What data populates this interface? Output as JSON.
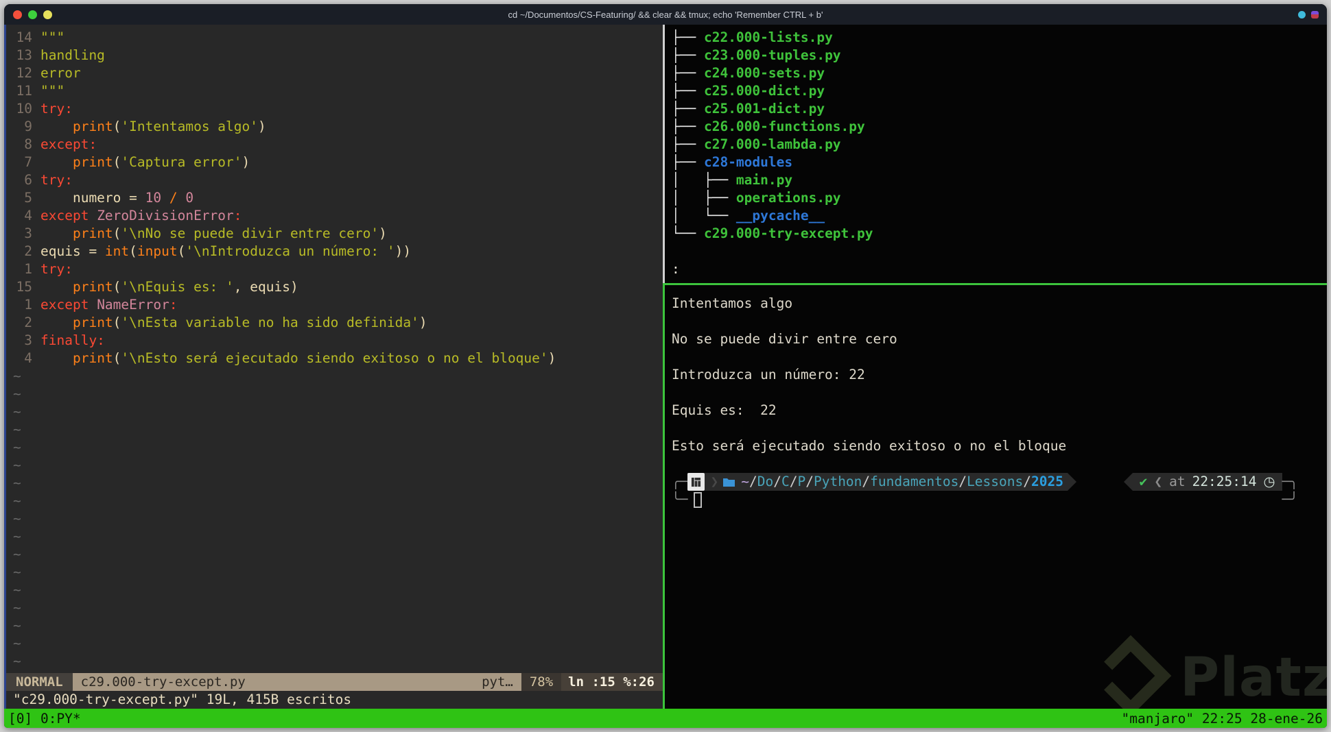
{
  "titlebar": {
    "title": "cd ~/Documentos/CS-Featuring/ && clear && tmux; echo 'Remember CTRL + b'"
  },
  "editor": {
    "lines": [
      {
        "n": "14",
        "parts": [
          [
            "\"\"\"",
            "str"
          ]
        ]
      },
      {
        "n": "13",
        "parts": [
          [
            "handling",
            "str"
          ]
        ]
      },
      {
        "n": "12",
        "parts": [
          [
            "error",
            "str"
          ]
        ]
      },
      {
        "n": "11",
        "parts": [
          [
            "\"\"\"",
            "str"
          ]
        ]
      },
      {
        "n": "10",
        "parts": [
          [
            "try:",
            "kw"
          ]
        ]
      },
      {
        "n": "9",
        "parts": [
          [
            "    ",
            "pl"
          ],
          [
            "print",
            "fn"
          ],
          [
            "(",
            "pl"
          ],
          [
            "'Intentamos algo'",
            "str"
          ],
          [
            ")",
            "pl"
          ]
        ]
      },
      {
        "n": "8",
        "parts": [
          [
            "except:",
            "kw"
          ]
        ]
      },
      {
        "n": "7",
        "parts": [
          [
            "    ",
            "pl"
          ],
          [
            "print",
            "fn"
          ],
          [
            "(",
            "pl"
          ],
          [
            "'Captura error'",
            "str"
          ],
          [
            ")",
            "pl"
          ]
        ]
      },
      {
        "n": "6",
        "parts": [
          [
            "try:",
            "kw"
          ]
        ]
      },
      {
        "n": "5",
        "parts": [
          [
            "    numero = ",
            "pl"
          ],
          [
            "10",
            "num"
          ],
          [
            " ",
            "pl"
          ],
          [
            "/",
            "fn"
          ],
          [
            " ",
            "pl"
          ],
          [
            "0",
            "num"
          ]
        ]
      },
      {
        "n": "4",
        "parts": [
          [
            "except ",
            "kw"
          ],
          [
            "ZeroDivisionError",
            "exc"
          ],
          [
            ":",
            "kw"
          ]
        ]
      },
      {
        "n": "3",
        "parts": [
          [
            "    ",
            "pl"
          ],
          [
            "print",
            "fn"
          ],
          [
            "(",
            "pl"
          ],
          [
            "'\\nNo se puede divir entre cero'",
            "str"
          ],
          [
            ")",
            "pl"
          ]
        ]
      },
      {
        "n": "2",
        "parts": [
          [
            "equis = ",
            "pl"
          ],
          [
            "int",
            "fn"
          ],
          [
            "(",
            "pl"
          ],
          [
            "input",
            "fn"
          ],
          [
            "(",
            "pl"
          ],
          [
            "'\\nIntroduzca un número: '",
            "str"
          ],
          [
            "))",
            "pl"
          ]
        ]
      },
      {
        "n": "1",
        "parts": [
          [
            "try:",
            "kw"
          ]
        ]
      },
      {
        "n": "15",
        "parts": [
          [
            "    ",
            "pl"
          ],
          [
            "print",
            "fn"
          ],
          [
            "(",
            "pl"
          ],
          [
            "'\\nEquis es: '",
            "str"
          ],
          [
            ", equis",
            "pl"
          ],
          [
            ")",
            "pl"
          ]
        ]
      },
      {
        "n": "1",
        "parts": [
          [
            "except ",
            "kw"
          ],
          [
            "NameError",
            "exc"
          ],
          [
            ":",
            "kw"
          ]
        ]
      },
      {
        "n": "2",
        "parts": [
          [
            "    ",
            "pl"
          ],
          [
            "print",
            "fn"
          ],
          [
            "(",
            "pl"
          ],
          [
            "'\\nEsta variable no ha sido definida'",
            "str"
          ],
          [
            ")",
            "pl"
          ]
        ]
      },
      {
        "n": "3",
        "parts": [
          [
            "finally:",
            "kw"
          ]
        ]
      },
      {
        "n": "4",
        "parts": [
          [
            "    ",
            "pl"
          ],
          [
            "print",
            "fn"
          ],
          [
            "(",
            "pl"
          ],
          [
            "'\\nEsto será ejecutado siendo exitoso o no el bloque'",
            "str"
          ],
          [
            ")",
            "pl"
          ]
        ]
      }
    ],
    "tilde_rows": 17,
    "statusline": {
      "mode": "NORMAL",
      "filename": "c29.000-try-except.py",
      "filetype": "pyt…",
      "percent": "78%",
      "position": "ln :15 %:26"
    },
    "message": "\"c29.000-try-except.py\" 19L, 415B escritos"
  },
  "tree": {
    "items": [
      {
        "prefix": "├── ",
        "name": "c22.000-lists.py",
        "type": "file"
      },
      {
        "prefix": "├── ",
        "name": "c23.000-tuples.py",
        "type": "file"
      },
      {
        "prefix": "├── ",
        "name": "c24.000-sets.py",
        "type": "file"
      },
      {
        "prefix": "├── ",
        "name": "c25.000-dict.py",
        "type": "file"
      },
      {
        "prefix": "├── ",
        "name": "c25.001-dict.py",
        "type": "file"
      },
      {
        "prefix": "├── ",
        "name": "c26.000-functions.py",
        "type": "file"
      },
      {
        "prefix": "├── ",
        "name": "c27.000-lambda.py",
        "type": "file"
      },
      {
        "prefix": "├── ",
        "name": "c28-modules",
        "type": "dir"
      },
      {
        "prefix": "│   ├── ",
        "name": "main.py",
        "type": "file"
      },
      {
        "prefix": "│   ├── ",
        "name": "operations.py",
        "type": "file"
      },
      {
        "prefix": "│   └── ",
        "name": "__pycache__",
        "type": "dir"
      },
      {
        "prefix": "└── ",
        "name": "c29.000-try-except.py",
        "type": "file"
      }
    ],
    "pager_prompt": ":"
  },
  "terminal": {
    "output_lines": [
      "Intentamos algo",
      "",
      "No se puede divir entre cero",
      "",
      "Introduzca un número: 22",
      "",
      "Equis es:  22",
      "",
      "Esto será ejecutado siendo exitoso o no el bloque"
    ],
    "prompt": {
      "frame_tl": "╭─",
      "frame_tr": "─╮",
      "frame_bl": "╰─",
      "frame_br": "─╯",
      "path_tilde": "~",
      "path_dirs": [
        "Do",
        "C",
        "P",
        "Python",
        "fundamentos",
        "Lessons"
      ],
      "path_tail": "2025",
      "chevron": "❯",
      "status_check": "✔",
      "status_sep": "❮",
      "status_at": "at",
      "time": "22:25:14",
      "clock_glyph": "◷"
    }
  },
  "tmux_bar": {
    "left": "[0] 0:PY*",
    "right": "\"manjaro\" 22:25 28-ene-26"
  },
  "watermark": {
    "text": "Platzi"
  }
}
